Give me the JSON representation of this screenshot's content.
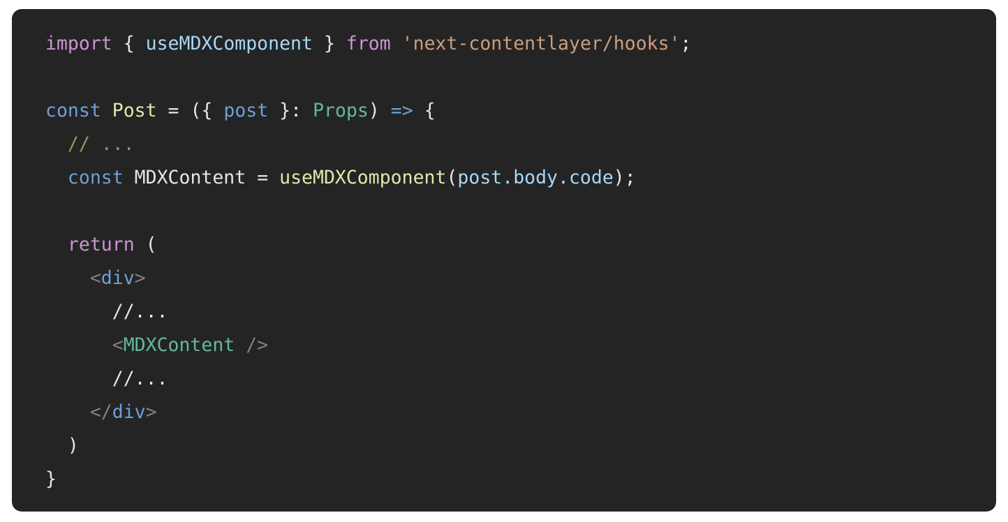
{
  "card": {
    "name": "code-snippet-card",
    "background_color": "#242424",
    "page_background_color": "#ffffff",
    "border_radius_px": 14
  },
  "code": {
    "language": "tsx",
    "font_size_px": 26.5,
    "line_height_px": 48,
    "full_text": "import { useMDXComponent } from 'next-contentlayer/hooks';\n\nconst Post = ({ post }: Props) => {\n  // ...\n  const MDXContent = useMDXComponent(post.body.code);\n\n  return (\n    <div>\n      //...\n      <MDXContent />\n      //...\n    </div>\n  )\n}",
    "lines": [
      {
        "n": 1,
        "text": "import { useMDXComponent } from 'next-contentlayer/hooks';",
        "tokens": [
          {
            "t": "import",
            "c": "keyword"
          },
          {
            "t": " ",
            "c": "plain"
          },
          {
            "t": "{",
            "c": "plain"
          },
          {
            "t": " ",
            "c": "plain"
          },
          {
            "t": "useMDXComponent",
            "c": "ident"
          },
          {
            "t": " ",
            "c": "plain"
          },
          {
            "t": "}",
            "c": "plain"
          },
          {
            "t": " ",
            "c": "plain"
          },
          {
            "t": "from",
            "c": "keyword"
          },
          {
            "t": " ",
            "c": "plain"
          },
          {
            "t": "'next-contentlayer/hooks'",
            "c": "string"
          },
          {
            "t": ";",
            "c": "plain"
          }
        ]
      },
      {
        "n": 2,
        "text": "",
        "tokens": []
      },
      {
        "n": 3,
        "text": "const Post = ({ post }: Props) => {",
        "tokens": [
          {
            "t": "const",
            "c": "const"
          },
          {
            "t": " ",
            "c": "plain"
          },
          {
            "t": "Post",
            "c": "func"
          },
          {
            "t": " ",
            "c": "plain"
          },
          {
            "t": "=",
            "c": "plain"
          },
          {
            "t": " ",
            "c": "plain"
          },
          {
            "t": "({",
            "c": "plain"
          },
          {
            "t": " ",
            "c": "plain"
          },
          {
            "t": "post",
            "c": "const"
          },
          {
            "t": " ",
            "c": "plain"
          },
          {
            "t": "}",
            "c": "plain"
          },
          {
            "t": ":",
            "c": "plain"
          },
          {
            "t": " ",
            "c": "plain"
          },
          {
            "t": "Props",
            "c": "type"
          },
          {
            "t": ")",
            "c": "plain"
          },
          {
            "t": " ",
            "c": "plain"
          },
          {
            "t": "=>",
            "c": "const"
          },
          {
            "t": " ",
            "c": "plain"
          },
          {
            "t": "{",
            "c": "plain"
          }
        ]
      },
      {
        "n": 4,
        "text": "  // ...",
        "tokens": [
          {
            "t": "  ",
            "c": "plain"
          },
          {
            "t": "// ...",
            "c": "comment"
          }
        ]
      },
      {
        "n": 5,
        "text": "  const MDXContent = useMDXComponent(post.body.code);",
        "tokens": [
          {
            "t": "  ",
            "c": "plain"
          },
          {
            "t": "const",
            "c": "const"
          },
          {
            "t": " ",
            "c": "plain"
          },
          {
            "t": "MDXContent",
            "c": "plain"
          },
          {
            "t": " ",
            "c": "plain"
          },
          {
            "t": "=",
            "c": "plain"
          },
          {
            "t": " ",
            "c": "plain"
          },
          {
            "t": "useMDXComponent",
            "c": "func"
          },
          {
            "t": "(",
            "c": "plain"
          },
          {
            "t": "post.body.code",
            "c": "ident"
          },
          {
            "t": ")",
            "c": "plain"
          },
          {
            "t": ";",
            "c": "plain"
          }
        ]
      },
      {
        "n": 6,
        "text": "",
        "tokens": []
      },
      {
        "n": 7,
        "text": "  return (",
        "tokens": [
          {
            "t": "  ",
            "c": "plain"
          },
          {
            "t": "return",
            "c": "keyword"
          },
          {
            "t": " ",
            "c": "plain"
          },
          {
            "t": "(",
            "c": "plain"
          }
        ]
      },
      {
        "n": 8,
        "text": "    <div>",
        "tokens": [
          {
            "t": "    ",
            "c": "plain"
          },
          {
            "t": "<",
            "c": "tagbr"
          },
          {
            "t": "div",
            "c": "const"
          },
          {
            "t": ">",
            "c": "tagbr"
          }
        ]
      },
      {
        "n": 9,
        "text": "      //...",
        "tokens": [
          {
            "t": "      ",
            "c": "plain"
          },
          {
            "t": "//...",
            "c": "plain"
          }
        ]
      },
      {
        "n": 10,
        "text": "      <MDXContent />",
        "tokens": [
          {
            "t": "      ",
            "c": "plain"
          },
          {
            "t": "<",
            "c": "tagbr"
          },
          {
            "t": "MDXContent",
            "c": "type"
          },
          {
            "t": " ",
            "c": "plain"
          },
          {
            "t": "/>",
            "c": "tagbr"
          }
        ]
      },
      {
        "n": 11,
        "text": "      //...",
        "tokens": [
          {
            "t": "      ",
            "c": "plain"
          },
          {
            "t": "//...",
            "c": "plain"
          }
        ]
      },
      {
        "n": 12,
        "text": "    </div>",
        "tokens": [
          {
            "t": "    ",
            "c": "plain"
          },
          {
            "t": "</",
            "c": "tagbr"
          },
          {
            "t": "div",
            "c": "const"
          },
          {
            "t": ">",
            "c": "tagbr"
          }
        ]
      },
      {
        "n": 13,
        "text": "  )",
        "tokens": [
          {
            "t": "  ",
            "c": "plain"
          },
          {
            "t": ")",
            "c": "plain"
          }
        ]
      },
      {
        "n": 14,
        "text": "}",
        "tokens": [
          {
            "t": "}",
            "c": "plain"
          }
        ]
      }
    ]
  },
  "theme": {
    "keyword": "#cb94d4",
    "const": "#6f9fd8",
    "ident": "#a6d8f7",
    "func": "#e4e6ab",
    "type": "#64b99a",
    "string": "#cc9d7e",
    "comment": "#83a165",
    "plain": "#e6e6e6",
    "tagbr": "#808080"
  }
}
